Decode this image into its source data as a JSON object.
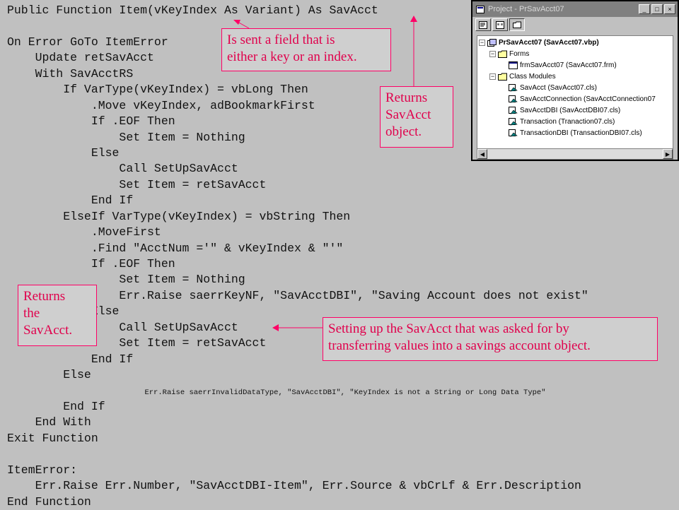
{
  "code_lines": [
    {
      "text": "Public Function Item(vKeyIndex As Variant) As SavAcct"
    },
    {
      "text": ""
    },
    {
      "text": "On Error GoTo ItemError"
    },
    {
      "text": "    Update retSavAcct"
    },
    {
      "text": "    With SavAcctRS"
    },
    {
      "text": "        If VarType(vKeyIndex) = vbLong Then"
    },
    {
      "text": "            .Move vKeyIndex, adBookmarkFirst"
    },
    {
      "text": "            If .EOF Then"
    },
    {
      "text": "                Set Item = Nothing"
    },
    {
      "text": "            Else"
    },
    {
      "text": "                Call SetUpSavAcct"
    },
    {
      "text": "                Set Item = retSavAcct"
    },
    {
      "text": "            End If"
    },
    {
      "text": "        ElseIf VarType(vKeyIndex) = vbString Then"
    },
    {
      "text": "            .MoveFirst"
    },
    {
      "text": "            .Find \"AcctNum ='\" & vKeyIndex & \"'\""
    },
    {
      "text": "            If .EOF Then"
    },
    {
      "text": "                Set Item = Nothing"
    },
    {
      "text": "                Err.Raise saerrKeyNF, \"SavAcctDBI\", \"Saving Account does not exist\""
    },
    {
      "text": "            Else"
    },
    {
      "text": "                Call SetUpSavAcct"
    },
    {
      "text": "                Set Item = retSavAcct"
    },
    {
      "text": "            End If"
    },
    {
      "text": "        Else"
    },
    {
      "text": "            Err.Raise saerrInvalidDataType, \"SavAcctDBI\", \"KeyIndex is not a String or Long Data Type\"",
      "small": true,
      "indent": "            "
    },
    {
      "text": "        End If"
    },
    {
      "text": "    End With"
    },
    {
      "text": "Exit Function"
    },
    {
      "text": ""
    },
    {
      "text": "ItemError:"
    },
    {
      "text": "    Err.Raise Err.Number, \"SavAcctDBI-Item\", Err.Source & vbCrLf & Err.Description"
    },
    {
      "text": "End Function"
    }
  ],
  "callouts": {
    "key_index": [
      "Is sent a field that is",
      "either a key or an index."
    ],
    "returns_savacct_object": [
      "Returns",
      "SavAcct",
      "object."
    ],
    "returns_the_savacct": [
      "Returns",
      "the",
      "SavAcct."
    ],
    "setting_up": [
      "Setting up the SavAcct that was asked for by",
      "transferring values into a savings account object."
    ]
  },
  "project_window": {
    "title": "Project - PrSavAcct07",
    "title_buttons": [
      "_",
      "□",
      "×"
    ],
    "tree": {
      "project": "PrSavAcct07 (SavAcct07.vbp)",
      "forms_folder": "Forms",
      "forms": [
        "frmSavAcct07 (SavAcct07.frm)"
      ],
      "class_folder": "Class Modules",
      "classes": [
        "SavAcct (SavAcct07.cls)",
        "SavAcctConnection (SavAcctConnection07",
        "SavAcctDBI (SavAcctDBI07.cls)",
        "Transaction (Tranaction07.cls)",
        "TransactionDBI (TransactionDBI07.cls)"
      ]
    }
  },
  "colors": {
    "annotation": "#e0004c",
    "background": "#c0c0c0"
  }
}
